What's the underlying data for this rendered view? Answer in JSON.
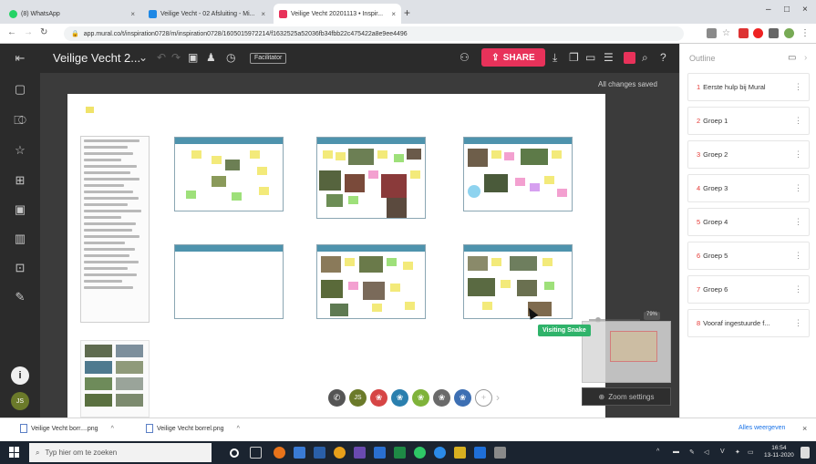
{
  "browser": {
    "tabs": [
      {
        "label": "(8) WhatsApp",
        "active": false,
        "favicon_color": "#25d366"
      },
      {
        "label": "Veilige Vecht - 02 Afsluiting - Mi...",
        "active": false,
        "favicon_color": "#1e88e5"
      },
      {
        "label": "Veilige Vecht 20201113 • Inspir...",
        "active": true,
        "favicon_color": "#e8325a"
      }
    ],
    "new_tab": "+",
    "window_controls": {
      "minimize": "–",
      "maximize": "□",
      "close": "×"
    },
    "url": "app.mural.co/t/inspiration0728/m/inspiration0728/1605015972214/f1632525a52036fb34fbb22c475422a8e9ee4496"
  },
  "mural": {
    "board_title": "Veilige Vecht 2...",
    "facilitator_label": "Facilitator",
    "share_label": "SHARE",
    "saved_status": "All changes saved",
    "visitor_tag": "Visiting Snake",
    "zoom_percent": "79%",
    "zoom_settings_label": "Zoom settings",
    "collaborators": [
      {
        "icon": "phone-icon",
        "color": "#555555",
        "text": "✆"
      },
      {
        "icon": "avatar-initials",
        "color": "#6b7a2a",
        "text": "JS"
      },
      {
        "icon": "animal-avatar-icon",
        "color": "#d64545",
        "text": "❀"
      },
      {
        "icon": "animal-avatar-icon",
        "color": "#2a7fae",
        "text": "❀"
      },
      {
        "icon": "animal-avatar-icon",
        "color": "#7fb33a",
        "text": "❀"
      },
      {
        "icon": "animal-avatar-icon",
        "color": "#6a6a6a",
        "text": "❀"
      },
      {
        "icon": "animal-avatar-icon",
        "color": "#3d6fb3",
        "text": "❀"
      }
    ],
    "add_collaborator": "+",
    "more_collaborators": "›"
  },
  "outline": {
    "title": "Outline",
    "items": [
      {
        "number": "1",
        "label": "Eerste hulp bij Mural"
      },
      {
        "number": "2",
        "label": "Groep 1"
      },
      {
        "number": "3",
        "label": "Groep 2"
      },
      {
        "number": "4",
        "label": "Groep 3"
      },
      {
        "number": "5",
        "label": "Groep 4"
      },
      {
        "number": "6",
        "label": "Groep 5"
      },
      {
        "number": "7",
        "label": "Groep 6"
      },
      {
        "number": "8",
        "label": "Vooraf ingestuurde f..."
      }
    ],
    "item_menu": "⋮"
  },
  "downloads": {
    "items": [
      "Veilige Vecht borr....png",
      "Veilige Vecht borrel.png"
    ],
    "show_all": "Alles weergeven"
  },
  "taskbar": {
    "search_placeholder": "Typ hier om te zoeken",
    "time": "16:54",
    "date": "13-11-2020"
  },
  "colors": {
    "accent": "#e8325a",
    "frame_header": "#4e93ad",
    "visitor_green": "#2fb36a",
    "outline_number": "#e53935"
  }
}
